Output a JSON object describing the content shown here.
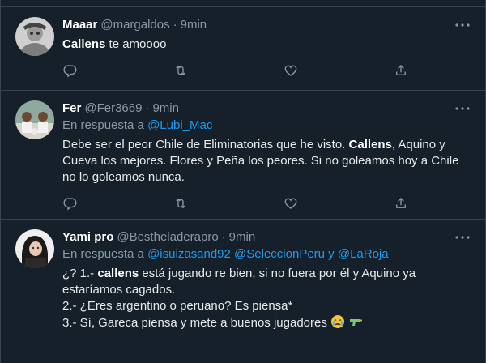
{
  "tweets": [
    {
      "display_name": "Maaar",
      "handle": "@margaldos",
      "dot": "·",
      "time": "9min",
      "text_bold": "Callens",
      "text_rest": " te amoooo"
    },
    {
      "display_name": "Fer",
      "handle": "@Fer3669",
      "dot": "·",
      "time": "9min",
      "reply_prefix": "En respuesta a ",
      "reply_mention": "@Lubi_Mac",
      "text_part1": "Debe ser el peor Chile de Eliminatorias que he visto. ",
      "text_bold": "Callens",
      "text_part2": ", Aquino y Cueva los mejores. Flores y Peña los peores. Si no goleamos hoy a Chile no lo goleamos nunca."
    },
    {
      "display_name": "Yami pro",
      "handle": "@Bestheladerapro",
      "dot": "·",
      "time": "9min",
      "reply_prefix": "En respuesta a ",
      "reply_mention1": "@isuizasand92",
      "reply_mention2": "@SeleccionPeru",
      "reply_and": " y ",
      "reply_mention3": "@LaRoja",
      "line1_pre": "¿? 1.- ",
      "line1_bold": "callens",
      "line1_post": " está jugando re bien, si no fuera por él y Aquino ya estaríamos cagados.",
      "line2": "2.- ¿Eres argentino o peruano? Es piensa*",
      "line3": "3.- Sí, Gareca piensa y mete a buenos jugadores"
    }
  ],
  "icons": {
    "reply": "reply-icon",
    "retweet": "retweet-icon",
    "like": "like-icon",
    "share": "share-icon",
    "more": "more-icon"
  },
  "colors": {
    "background": "#15202b",
    "border": "#38444d",
    "secondary_text": "#8b98a5",
    "link": "#1d9bf0"
  }
}
